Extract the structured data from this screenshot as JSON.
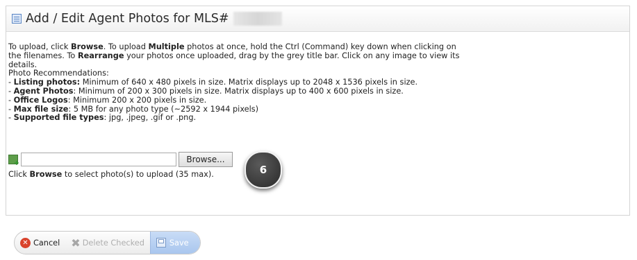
{
  "header": {
    "title": "Add / Edit Agent Photos for MLS#",
    "icon": "document-icon"
  },
  "instructions": {
    "p1_a": "To upload, click ",
    "p1_b": "Browse",
    "p1_c": ". To upload ",
    "p1_d": "Multiple",
    "p1_e": " photos at once, hold the Ctrl (Command) key down when clicking on the filenames. To ",
    "p1_f": "Rearrange",
    "p1_g": " your photos once uploaded, drag by the grey title bar. Click on any image to view its details.",
    "rec_heading": "Photo Recommendations:",
    "listing_label": "Listing photos:",
    "listing_text": " Minimum of 640 x 480 pixels in size. Matrix displays up to 2048 x 1536 pixels in size.",
    "agent_label": "Agent Photos",
    "agent_text": ": Minimum of 200 x 300 pixels in size. Matrix displays up to 400 x 600 pixels in size.",
    "office_label": "Office Logos",
    "office_text": ": Minimum 200 x 200 pixels in size.",
    "maxsize_label": "Max file size",
    "maxsize_text": ": 5 MB for any photo type (~2592 x 1944 pixels)",
    "types_label": "Supported file types",
    "types_text": ": jpg, .jpeg, .gif or .png."
  },
  "upload": {
    "browse_label": "Browse...",
    "file_value": "",
    "hint_a": "Click ",
    "hint_b": "Browse",
    "hint_c": " to select photo(s) to upload (35 max)."
  },
  "callout": {
    "number": "6"
  },
  "toolbar": {
    "cancel_label": "Cancel",
    "delete_label": "Delete Checked",
    "save_label": "Save"
  }
}
